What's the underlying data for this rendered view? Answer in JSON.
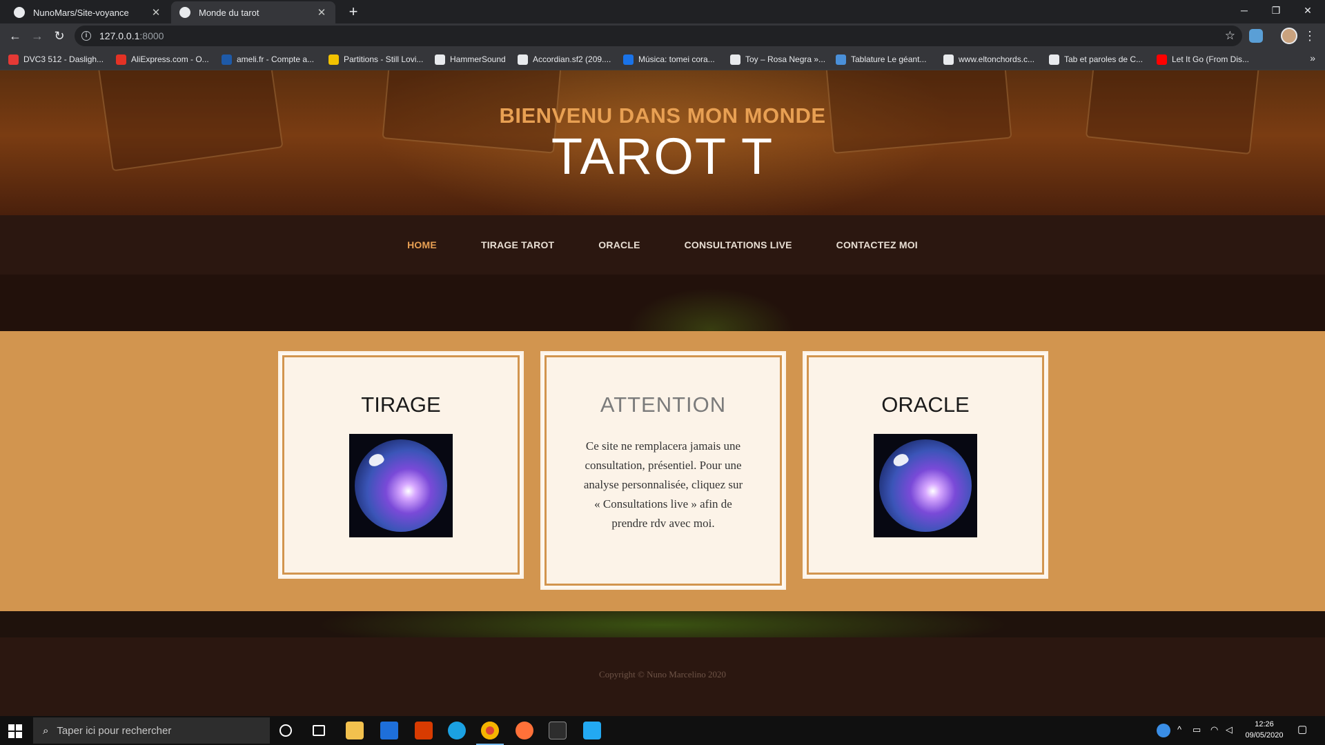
{
  "browser": {
    "tabs": [
      {
        "title": "NunoMars/Site-voyance",
        "active": false
      },
      {
        "title": "Monde du tarot",
        "active": true
      }
    ],
    "url_host": "127.0.0.1",
    "url_port": ":8000",
    "bookmarks": [
      {
        "label": "DVC3 512 - Dasligh...",
        "icon_color": "#e53935"
      },
      {
        "label": "AliExpress.com - O...",
        "icon_color": "#e43225"
      },
      {
        "label": "ameli.fr - Compte a...",
        "icon_color": "#1e5aa8"
      },
      {
        "label": "Partitions - Still Lovi...",
        "icon_color": "#f2c200"
      },
      {
        "label": "HammerSound",
        "icon_color": "#e8eaed"
      },
      {
        "label": "Accordian.sf2 (209....",
        "icon_color": "#e8eaed"
      },
      {
        "label": "Música: tomei cora...",
        "icon_color": "#1a73e8"
      },
      {
        "label": "Toy – Rosa Negra »...",
        "icon_color": "#e8eaed"
      },
      {
        "label": "Tablature Le géant...",
        "icon_color": "#4a90d9"
      },
      {
        "label": "www.eltonchords.c...",
        "icon_color": "#e8eaed"
      },
      {
        "label": "Tab et paroles de C...",
        "icon_color": "#e8eaed"
      },
      {
        "label": "Let It Go (From Dis...",
        "icon_color": "#ff0000"
      }
    ]
  },
  "hero": {
    "subtitle": "BIENVENU DANS MON MONDE",
    "title": "TAROT T"
  },
  "nav": {
    "items": [
      {
        "label": "HOME",
        "active": true
      },
      {
        "label": "TIRAGE TAROT",
        "active": false
      },
      {
        "label": "ORACLE",
        "active": false
      },
      {
        "label": "CONSULTATIONS LIVE",
        "active": false
      },
      {
        "label": "CONTACTEZ MOI",
        "active": false
      }
    ]
  },
  "boxes": {
    "left": {
      "title": "TIRAGE"
    },
    "mid": {
      "title": "ATTENTION",
      "text": "Ce site ne remplacera jamais une consultation, présentiel. Pour une analyse personnalisée, cliquez sur « Consultations live » afin de prendre rdv avec moi."
    },
    "right": {
      "title": "ORACLE"
    }
  },
  "footer": {
    "copyright": "Copyright © Nuno Marcelino 2020"
  },
  "taskbar": {
    "search_placeholder": "Taper ici pour rechercher",
    "time": "12:26",
    "date": "09/05/2020"
  },
  "colors": {
    "accent": "#e8a053",
    "content_bg": "#d2954f",
    "nav_bg": "#2b1710",
    "box_bg": "#fcf3e8"
  }
}
